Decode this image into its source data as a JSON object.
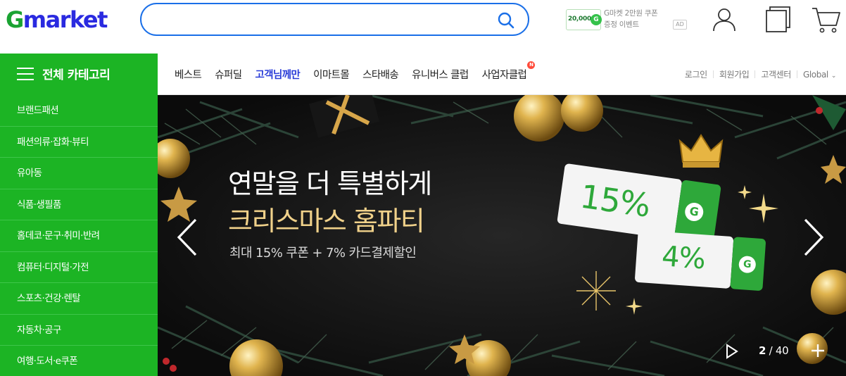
{
  "header": {
    "logo": {
      "g": "G",
      "rest": "market"
    },
    "search": {
      "placeholder": "",
      "value": ""
    },
    "ad": {
      "coupon_amount": "20,000",
      "coupon_badge": "G",
      "line1": "G마켓 2만원 쿠폰",
      "line2": "증정 이벤트",
      "tag": "AD"
    },
    "icons": [
      "user-icon",
      "recent-items-icon",
      "cart-icon"
    ]
  },
  "nav": {
    "all_categories": "전체 카테고리",
    "menu": [
      {
        "label": "베스트"
      },
      {
        "label": "슈퍼딜"
      },
      {
        "label": "고객님께만",
        "active": true
      },
      {
        "label": "이마트몰"
      },
      {
        "label": "스타배송"
      },
      {
        "label": "유니버스 클럽"
      },
      {
        "label": "사업자클럽",
        "badge": "N"
      }
    ],
    "util": [
      "로그인",
      "회원가입",
      "고객센터",
      "Global"
    ]
  },
  "sidebar": {
    "categories": [
      "브랜드패션",
      "패션의류·잡화·뷰티",
      "유아동",
      "식품·생필품",
      "홈데코·문구·취미·반려",
      "컴퓨터·디지털·가전",
      "스포츠·건강·렌탈",
      "자동차·공구",
      "여행·도서·e쿠폰"
    ]
  },
  "banner": {
    "headline1": "연말을 더 특별하게",
    "headline2": "크리스마스 홈파티",
    "subline": "최대 15% 쿠폰 + 7% 카드결제할인",
    "tickets": [
      {
        "text": "15%",
        "badge": "G"
      },
      {
        "text": "4%",
        "badge": "G"
      }
    ],
    "pager": {
      "current": "2",
      "separator": " / ",
      "total": "40"
    }
  },
  "colors": {
    "brand_green": "#1cb424",
    "brand_blue": "#2a2ae0",
    "search_border": "#1a6fe8",
    "active_menu": "#2a3dd8",
    "gold": "#f0d18a"
  }
}
